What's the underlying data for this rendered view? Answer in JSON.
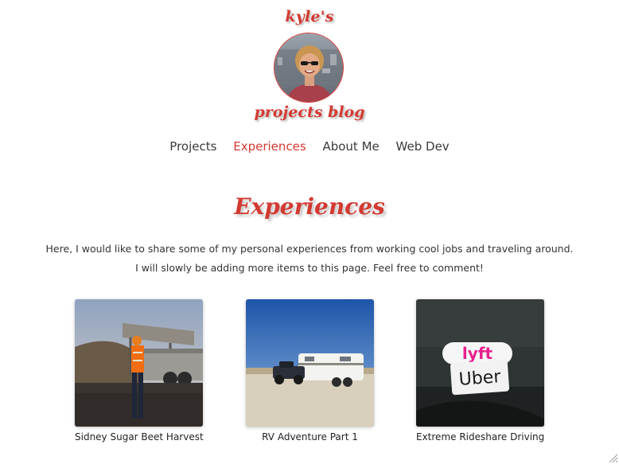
{
  "header": {
    "logo_top": "kyle's",
    "logo_bottom": "projects blog",
    "avatar_icon": "profile-photo"
  },
  "nav": {
    "items": [
      {
        "label": "Projects",
        "active": false
      },
      {
        "label": "Experiences",
        "active": true
      },
      {
        "label": "About Me",
        "active": false
      },
      {
        "label": "Web Dev",
        "active": false
      }
    ]
  },
  "main": {
    "title": "Experiences",
    "intro_line1": "Here, I would like to share some of my personal experiences from working cool jobs and traveling around.",
    "intro_line2": "I will slowly be adding more items to this page. Feel free to comment!"
  },
  "cards": [
    {
      "caption": "Sidney Sugar Beet Harvest",
      "image": "sugar-beet-harvest-photo"
    },
    {
      "caption": "RV Adventure Part 1",
      "image": "rv-truck-photo"
    },
    {
      "caption": "Extreme Rideshare Driving",
      "image": "lyft-uber-stickers-photo"
    }
  ],
  "colors": {
    "accent": "#d33a32",
    "nav_text": "#3a3a3a"
  }
}
